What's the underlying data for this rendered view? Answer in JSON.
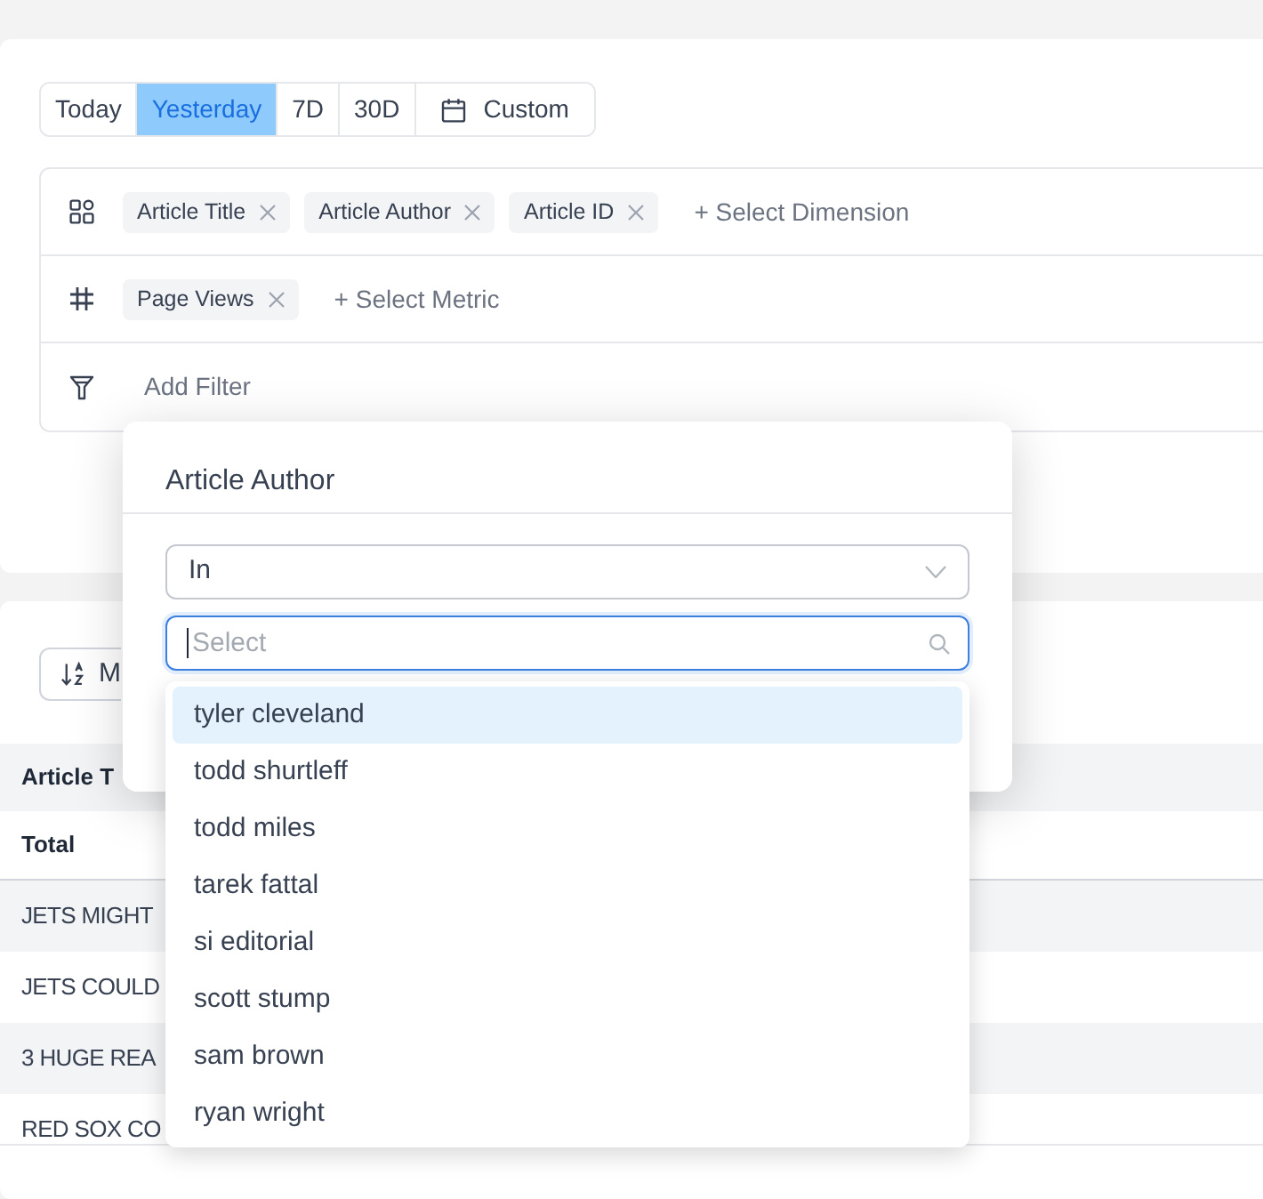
{
  "date_range": [
    {
      "label": "Today",
      "kind": "preset",
      "selected": false
    },
    {
      "label": "Yesterday",
      "kind": "preset",
      "selected": true
    },
    {
      "label": "7D",
      "kind": "preset",
      "selected": false
    },
    {
      "label": "30D",
      "kind": "preset",
      "selected": false
    },
    {
      "label": "Custom",
      "kind": "custom",
      "selected": false
    }
  ],
  "query_builder": [
    {
      "kind": "dimensions",
      "chips": [
        "Article Title",
        "Article Author",
        "Article ID"
      ],
      "add_label": "+ Select Dimension"
    },
    {
      "kind": "metrics",
      "chips": [
        "Page Views"
      ],
      "add_label": "+ Select Metric"
    },
    {
      "kind": "filters",
      "add_label": "Add Filter"
    }
  ],
  "sort_button": {
    "label": "M"
  },
  "table": {
    "columns": [
      "Article T"
    ],
    "total_row": [
      "Total"
    ],
    "rows": [
      [
        "JETS MIGHT"
      ],
      [
        "JETS COULD"
      ],
      [
        "3 HUGE REA"
      ],
      [
        "RED SOX CO"
      ]
    ]
  },
  "filter_popover": {
    "title": "Article Author",
    "operator": {
      "value": "In"
    },
    "search": {
      "placeholder": "Select",
      "focused": true
    },
    "options": [
      {
        "label": "tyler cleveland",
        "selected": true
      },
      {
        "label": "todd shurtleff",
        "selected": false
      },
      {
        "label": "todd miles",
        "selected": false
      },
      {
        "label": "tarek fattal",
        "selected": false
      },
      {
        "label": "si editorial",
        "selected": false
      },
      {
        "label": "scott stump",
        "selected": false
      },
      {
        "label": "sam brown",
        "selected": false
      },
      {
        "label": "ryan wright",
        "selected": false
      }
    ]
  }
}
